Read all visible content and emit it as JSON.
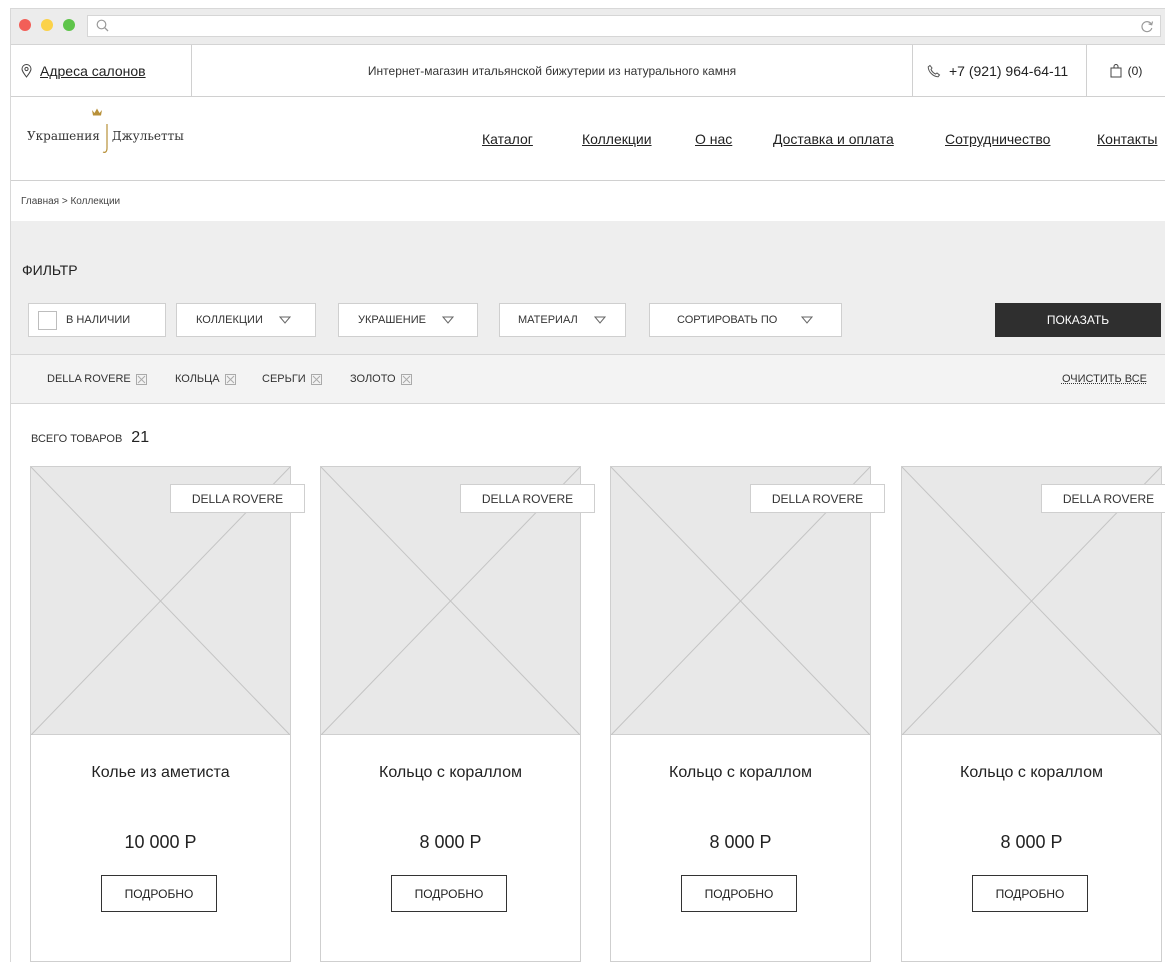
{
  "browser": {
    "address_value": ""
  },
  "topbar": {
    "salons_label": "Адреса салонов",
    "tagline": "Интернет-магазин итальянской бижутерии из натурального камня",
    "phone": "+7 (921) 964-64-11",
    "cart_count": "(0)"
  },
  "logo": {
    "left": "Украшения",
    "right": "Джульетты"
  },
  "nav": [
    "Каталог",
    "Коллекции",
    "О нас",
    "Доставка и оплата",
    "Сотрудничество",
    "Контакты"
  ],
  "breadcrumb": "Главная > Коллекции",
  "filter": {
    "title": "ФИЛЬТР",
    "in_stock": "В НАЛИЧИИ",
    "collections": "КОЛЛЕКЦИИ",
    "jewelry": "УКРАШЕНИЕ",
    "material": "МАТЕРИАЛ",
    "sort": "СОРТИРОВАТЬ ПО",
    "show": "ПОКАЗАТЬ"
  },
  "chips": [
    "DELLA ROVERE",
    "КОЛЬЦА",
    "СЕРЬГИ",
    "ЗОЛОТО"
  ],
  "clear_all": "ОЧИСТИТЬ ВСЕ",
  "total": {
    "label": "ВСЕГО ТОВАРОВ",
    "count": "21"
  },
  "products": [
    {
      "tag": "DELLA ROVERE",
      "name": "Колье из аметиста",
      "price": "10 000 Р",
      "button": "ПОДРОБНО"
    },
    {
      "tag": "DELLA ROVERE",
      "name": "Кольцо с кораллом",
      "price": "8 000 Р",
      "button": "ПОДРОБНО"
    },
    {
      "tag": "DELLA ROVERE",
      "name": "Кольцо с кораллом",
      "price": "8 000 Р",
      "button": "ПОДРОБНО"
    },
    {
      "tag": "DELLA ROVERE",
      "name": "Кольцо с кораллом",
      "price": "8 000 Р",
      "button": "ПОДРОБНО"
    }
  ],
  "icons": {
    "search": "search-icon",
    "refresh": "refresh-icon",
    "location": "location-pin-icon",
    "phone": "phone-icon",
    "cart": "shopping-bag-icon",
    "dropdown": "triangle-down-icon",
    "remove": "close-box-icon"
  }
}
